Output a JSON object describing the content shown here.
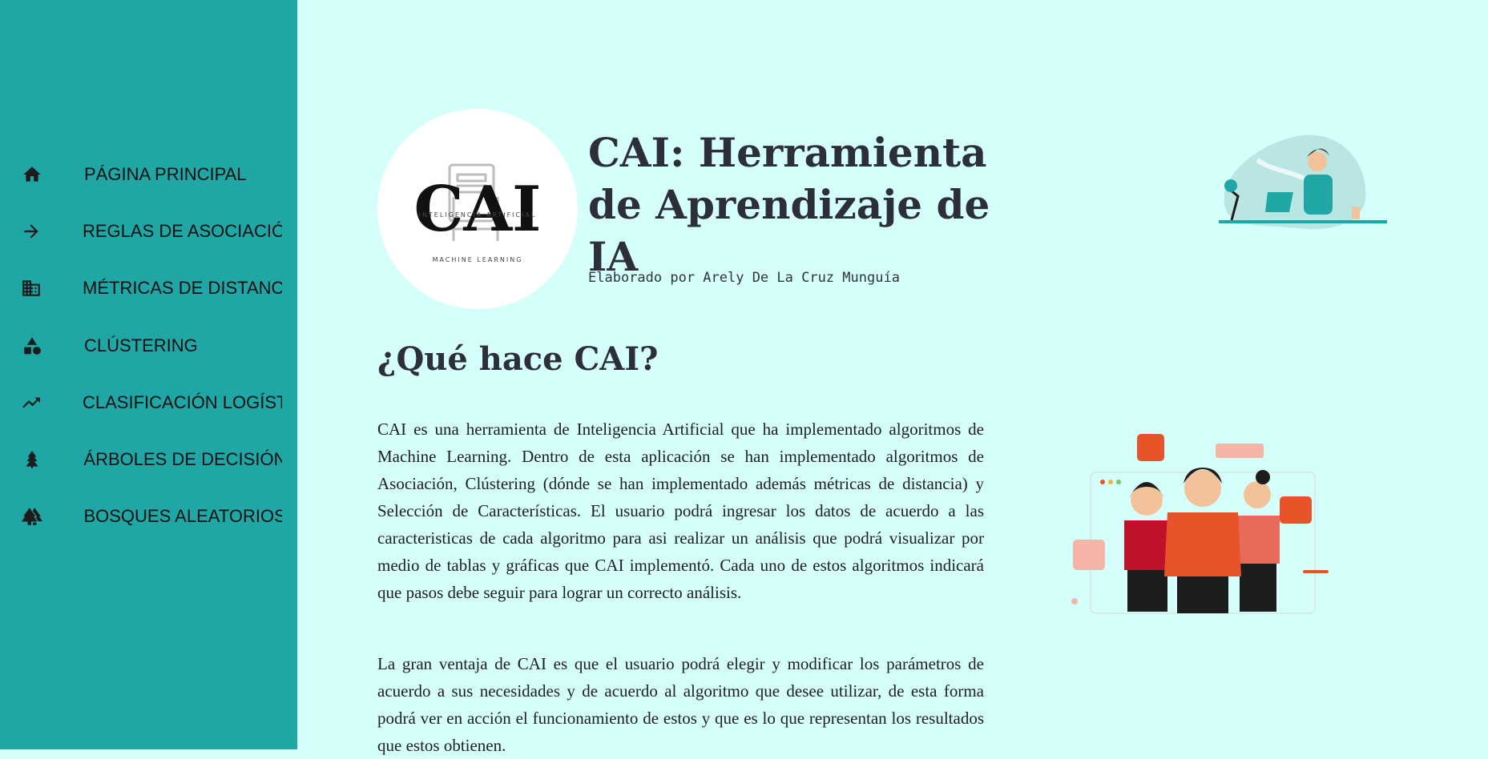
{
  "sidebar": {
    "items": [
      {
        "label": "PÁGINA PRINCIPAL",
        "icon": "home-icon"
      },
      {
        "label": "REGLAS DE ASOCIACIÓN",
        "icon": "arrow-right-icon"
      },
      {
        "label": "MÉTRICAS DE DISTANCIA",
        "icon": "building-icon"
      },
      {
        "label": "CLÚSTERING",
        "icon": "shapes-icon"
      },
      {
        "label": "CLASIFICACIÓN LOGÍSTICA",
        "icon": "trending-up-icon"
      },
      {
        "label": "ÁRBOLES DE DECISIÓN",
        "icon": "tree-icon"
      },
      {
        "label": "BOSQUES ALEATORIOS",
        "icon": "forest-icon"
      }
    ]
  },
  "header": {
    "title": "CAI: Herramienta de Aprendizaje de IA",
    "byline": "Elaborado por Arely De La Cruz Munguía",
    "logo": {
      "text": "CAI",
      "subtext_top": "INTELIGENCIA ARTIFICIAL",
      "subtext_bottom": "MACHINE LEARNING"
    }
  },
  "main": {
    "section_title": "¿Qué hace CAI?",
    "paragraph1": "CAI es una herramienta de Inteligencia Artificial que ha implementado algoritmos de Machine Learning. Dentro de esta aplicación se han implementado algoritmos de Asociación, Clústering (dónde se han implementado además métricas de distancia) y Selección de Características. El usuario podrá ingresar los datos de acuerdo a las caracteristicas de cada algoritmo para asi realizar un análisis que podrá visualizar por medio de tablas y gráficas que CAI implementó. Cada uno de estos algoritmos indicará que pasos debe seguir para lograr un correcto análisis.",
    "paragraph2": "La gran ventaja de CAI es que el usuario podrá elegir y modificar los parámetros de acuerdo a sus necesidades y de acuerdo al algoritmo que desee utilizar, de esta forma podrá ver en acción el funcionamiento de estos y que es lo que representan los resultados que estos obtienen."
  },
  "colors": {
    "sidebar_bg": "#1fa6a5",
    "page_bg": "#d4fffb",
    "accent_orange": "#e8542a",
    "text_dark": "#2c2f3a"
  }
}
